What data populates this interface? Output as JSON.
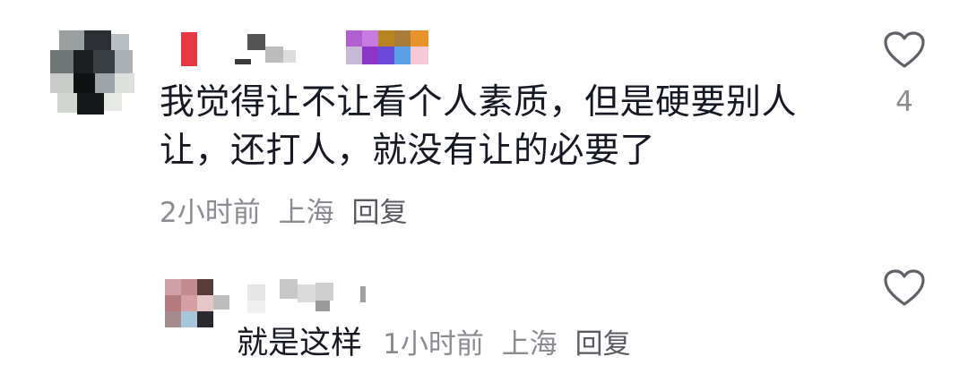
{
  "comment": {
    "text": "我觉得让不让看个人素质，但是硬要别人让，还打人，就没有让的必要了",
    "time": "2小时前",
    "location": "上海",
    "reply_label": "回复",
    "like_count": "4",
    "like_icon": "heart-outline-icon"
  },
  "reply": {
    "text": "就是这样",
    "time": "1小时前",
    "location": "上海",
    "reply_label": "回复",
    "like_icon": "heart-outline-icon"
  },
  "colors": {
    "text_primary": "#161823",
    "text_secondary": "#8a8b91",
    "icon_stroke": "#5f6068"
  }
}
